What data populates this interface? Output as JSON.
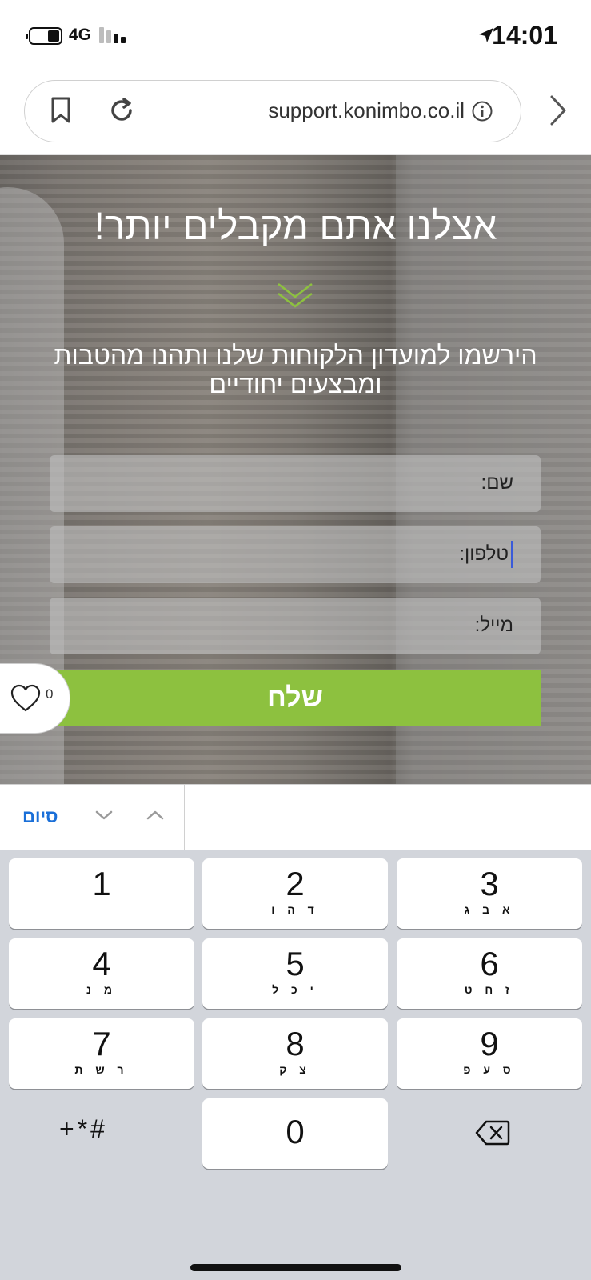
{
  "status_bar": {
    "network": "4G",
    "time": "14:01"
  },
  "browser": {
    "url": "support.konimbo.co.il"
  },
  "hero": {
    "title": "אצלנו אתם מקבלים יותר!",
    "subtitle": "הירשמו למועדון הלקוחות שלנו ותהנו מהטבות ומבצעים יחודיים",
    "accent_color": "#8dc13f"
  },
  "form": {
    "name_label": "שם:",
    "phone_label": "טלפון:",
    "email_label": "מייל:",
    "submit_label": "שלח"
  },
  "wishlist": {
    "count": "0"
  },
  "keyboard": {
    "done_label": "סיום",
    "keys": [
      {
        "num": "1",
        "letters": ""
      },
      {
        "num": "2",
        "letters": "ד ה ו"
      },
      {
        "num": "3",
        "letters": "א ב ג"
      },
      {
        "num": "4",
        "letters": "מ נ"
      },
      {
        "num": "5",
        "letters": "י כ ל"
      },
      {
        "num": "6",
        "letters": "ז ח ט"
      },
      {
        "num": "7",
        "letters": "ר ש ת"
      },
      {
        "num": "8",
        "letters": "צ ק"
      },
      {
        "num": "9",
        "letters": "ס ע פ"
      },
      {
        "num": "0",
        "letters": ""
      }
    ],
    "symbols_label": "+*#"
  },
  "icons": [
    "battery-icon",
    "signal-icon",
    "location-arrow-icon",
    "bookmark-icon",
    "reload-icon",
    "info-icon",
    "forward-icon",
    "chevron-down-double-icon",
    "heart-icon",
    "chevron-down-icon",
    "chevron-up-icon",
    "backspace-icon"
  ]
}
